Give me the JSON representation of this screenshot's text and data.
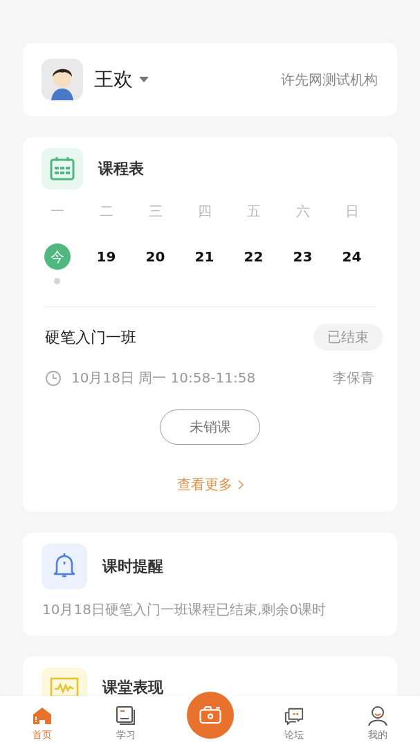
{
  "profile": {
    "name": "王欢",
    "org": "许先网测试机构"
  },
  "schedule": {
    "title": "课程表",
    "weekdays": [
      "一",
      "二",
      "三",
      "四",
      "五",
      "六",
      "日"
    ],
    "days": [
      {
        "label": "今",
        "today": true,
        "has_class": true
      },
      {
        "label": "19",
        "today": false,
        "has_class": false
      },
      {
        "label": "20",
        "today": false,
        "has_class": false
      },
      {
        "label": "21",
        "today": false,
        "has_class": false
      },
      {
        "label": "22",
        "today": false,
        "has_class": false
      },
      {
        "label": "23",
        "today": false,
        "has_class": false
      },
      {
        "label": "24",
        "today": false,
        "has_class": false
      }
    ],
    "lesson": {
      "name": "硬笔入门一班",
      "status": "已结束",
      "time": "10月18日 周一 10:58-11:58",
      "teacher": "李保青",
      "action": "未销课"
    },
    "more": "查看更多"
  },
  "reminder": {
    "title": "课时提醒",
    "text": "10月18日硬笔入门一班课程已结束,剩余0课时"
  },
  "performance": {
    "title": "课堂表现"
  },
  "tabs": [
    {
      "kind": "tab",
      "label": "首页",
      "selected": true
    },
    {
      "kind": "tab",
      "label": "学习",
      "selected": false
    },
    {
      "kind": "camera",
      "selected": false
    },
    {
      "kind": "tab",
      "label": "论坛",
      "selected": false
    },
    {
      "kind": "tab",
      "label": "我的",
      "selected": false
    }
  ]
}
